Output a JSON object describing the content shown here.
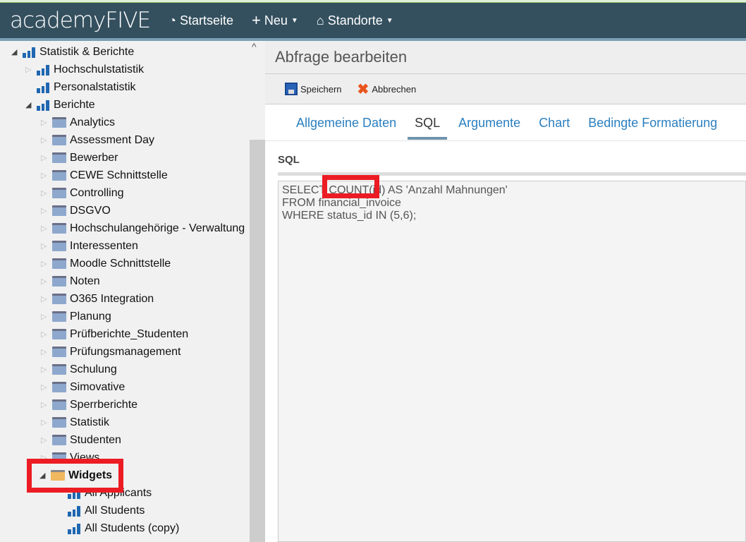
{
  "nav": {
    "logo": "academyFIVE",
    "items": [
      {
        "label": "Startseite",
        "icon": "dashboard-icon"
      },
      {
        "label": "Neu",
        "icon": "plus-icon"
      },
      {
        "label": "Standorte",
        "icon": "home-icon"
      }
    ]
  },
  "tree": {
    "root": "Statistik & Berichte",
    "level1": [
      "Hochschulstatistik",
      "Personalstatistik",
      "Berichte"
    ],
    "folders": [
      "Analytics",
      "Assessment Day",
      "Bewerber",
      "CEWE Schnittstelle",
      "Controlling",
      "DSGVO",
      "Hochschulangehörige - Verwaltung",
      "Interessenten",
      "Moodle Schnittstelle",
      "Noten",
      "O365 Integration",
      "Planung",
      "Prüfberichte_Studenten",
      "Prüfungsmanagement",
      "Schulung",
      "Simovative",
      "Sperrberichte",
      "Statistik",
      "Studenten",
      "Views"
    ],
    "open_folder": "Widgets",
    "widgets": [
      "All Applicants",
      "All Students",
      "All Students (copy)"
    ]
  },
  "main": {
    "title": "Abfrage bearbeiten",
    "toolbar": {
      "save": "Speichern",
      "cancel": "Abbrechen"
    },
    "tabs": [
      {
        "label": "Allgemeine Daten"
      },
      {
        "label": "SQL",
        "active": true
      },
      {
        "label": "Argumente"
      },
      {
        "label": "Chart"
      },
      {
        "label": "Bedingte Formatierung"
      }
    ],
    "sql_label": "SQL",
    "sql": "SELECT COUNT(id) AS 'Anzahl Mahnungen'\nFROM financial_invoice\nWHERE status_id IN (5,6);"
  },
  "colors": {
    "nav": "#34505f",
    "highlight": "#ec1c24",
    "link": "#2a7fc0"
  }
}
